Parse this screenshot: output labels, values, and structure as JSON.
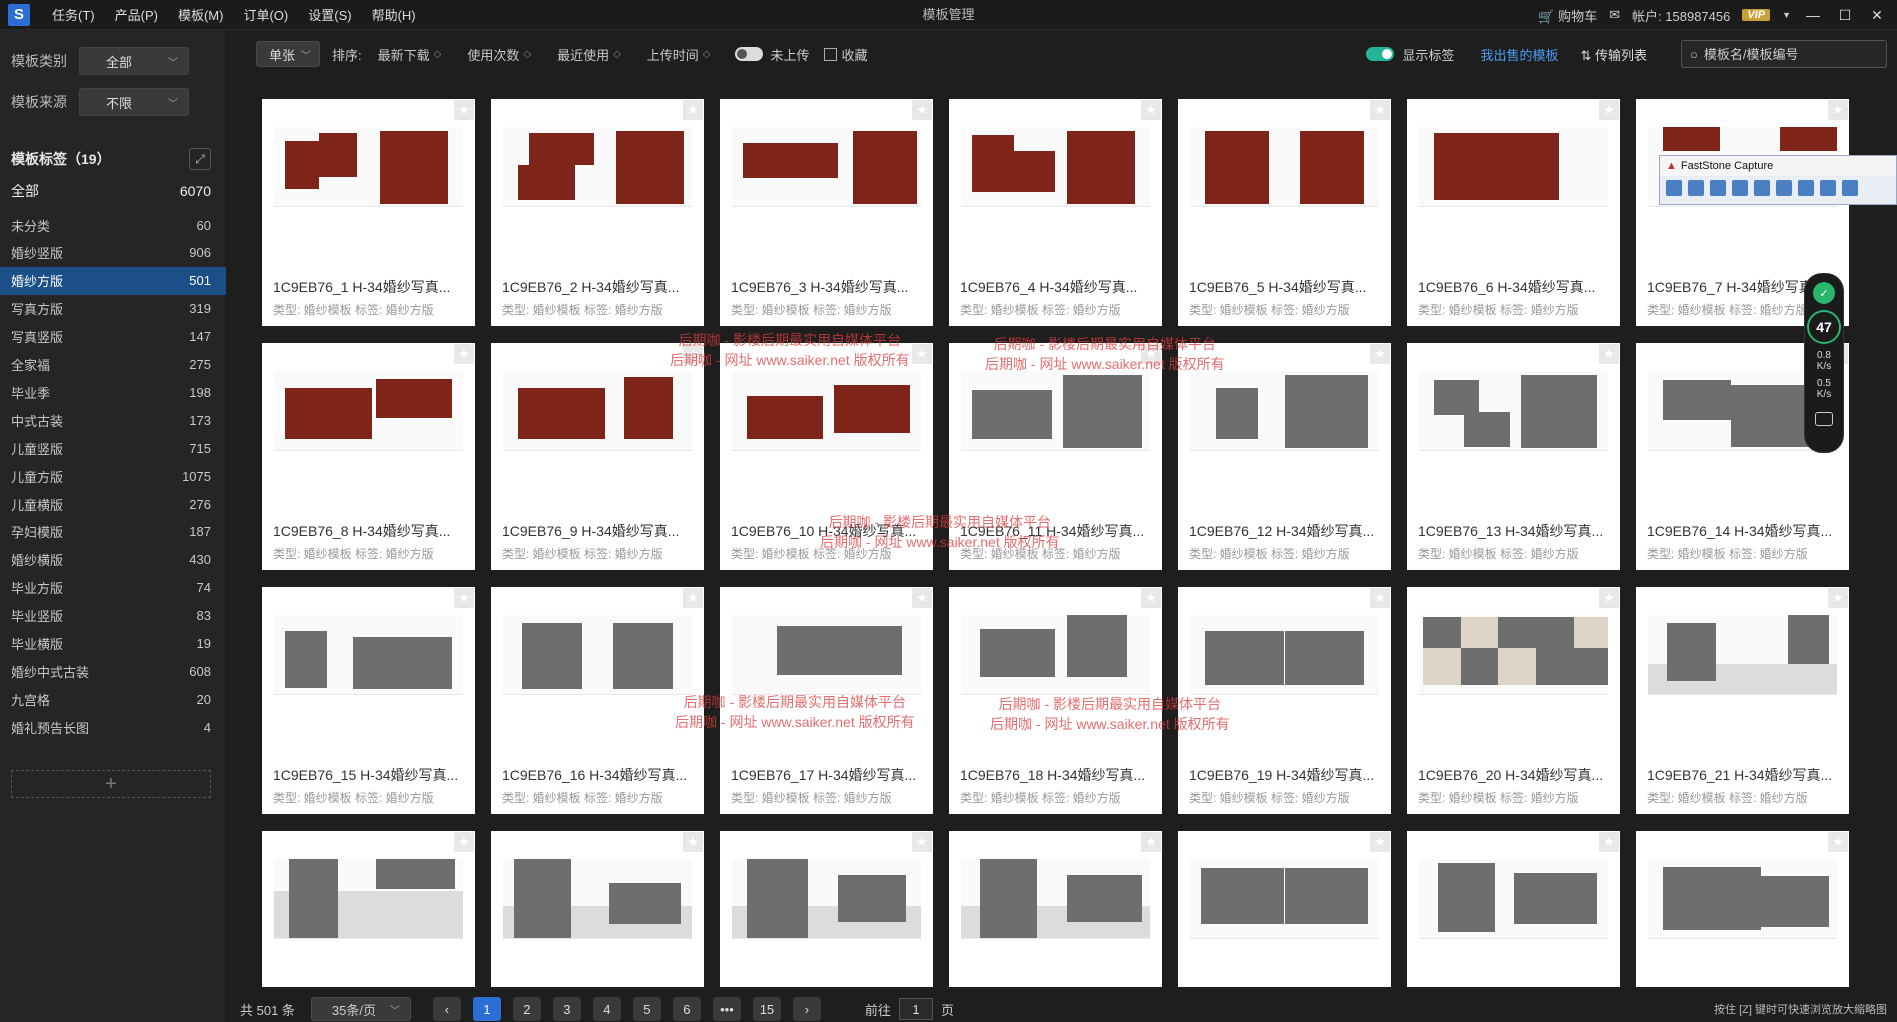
{
  "app": {
    "logo_letter": "S",
    "window_title": "模板管理",
    "menu": [
      "任务(T)",
      "产品(P)",
      "模板(M)",
      "订单(O)",
      "设置(S)",
      "帮助(H)"
    ],
    "cart_label": "购物车",
    "account_label": "帐户: 158987456",
    "vip_label": "VIP"
  },
  "sidebar": {
    "category_label": "模板类别",
    "category_value": "全部",
    "source_label": "模板来源",
    "source_value": "不限",
    "tags_title": "模板标签（19）",
    "tags": [
      {
        "name": "全部",
        "count": "6070"
      },
      {
        "name": "未分类",
        "count": "60"
      },
      {
        "name": "婚纱竖版",
        "count": "906"
      },
      {
        "name": "婚纱方版",
        "count": "501"
      },
      {
        "name": "写真方版",
        "count": "319"
      },
      {
        "name": "写真竖版",
        "count": "147"
      },
      {
        "name": "全家福",
        "count": "275"
      },
      {
        "name": "毕业季",
        "count": "198"
      },
      {
        "name": "中式古装",
        "count": "173"
      },
      {
        "name": "儿童竖版",
        "count": "715"
      },
      {
        "name": "儿童方版",
        "count": "1075"
      },
      {
        "name": "儿童横版",
        "count": "276"
      },
      {
        "name": "孕妇模版",
        "count": "187"
      },
      {
        "name": "婚纱横版",
        "count": "430"
      },
      {
        "name": "毕业方版",
        "count": "74"
      },
      {
        "name": "毕业竖版",
        "count": "83"
      },
      {
        "name": "毕业横版",
        "count": "19"
      },
      {
        "name": "婚纱中式古装",
        "count": "608"
      },
      {
        "name": "九宫格",
        "count": "20"
      },
      {
        "name": "婚礼预告长图",
        "count": "4"
      }
    ],
    "add_symbol": "+"
  },
  "toolbar": {
    "mode": "单张",
    "sort_label": "排序:",
    "sort_options": [
      "最新下载",
      "使用次数",
      "最近使用",
      "上传时间"
    ],
    "not_uploaded": "未上传",
    "favorites": "收藏",
    "show_tags": "显示标签",
    "my_sold": "我出售的模板",
    "transfer_list": "传输列表",
    "search_placeholder": "模板名/模板编号"
  },
  "cards": [
    {
      "name": "1C9EB76_1  H-34婚纱写真...",
      "meta": "类型: 婚纱模板    标签: 婚纱方版"
    },
    {
      "name": "1C9EB76_2  H-34婚纱写真...",
      "meta": "类型: 婚纱模板    标签: 婚纱方版"
    },
    {
      "name": "1C9EB76_3  H-34婚纱写真...",
      "meta": "类型: 婚纱模板    标签: 婚纱方版"
    },
    {
      "name": "1C9EB76_4  H-34婚纱写真...",
      "meta": "类型: 婚纱模板    标签: 婚纱方版"
    },
    {
      "name": "1C9EB76_5  H-34婚纱写真...",
      "meta": "类型: 婚纱模板    标签: 婚纱方版"
    },
    {
      "name": "1C9EB76_6  H-34婚纱写真...",
      "meta": "类型: 婚纱模板    标签: 婚纱方版"
    },
    {
      "name": "1C9EB76_7  H-34婚纱写真...",
      "meta": "类型: 婚纱模板    标签: 婚纱方版"
    },
    {
      "name": "1C9EB76_8  H-34婚纱写真...",
      "meta": "类型: 婚纱模板    标签: 婚纱方版"
    },
    {
      "name": "1C9EB76_9  H-34婚纱写真...",
      "meta": "类型: 婚纱模板    标签: 婚纱方版"
    },
    {
      "name": "1C9EB76_10  H-34婚纱写真...",
      "meta": "类型: 婚纱模板    标签: 婚纱方版"
    },
    {
      "name": "1C9EB76_11  H-34婚纱写真...",
      "meta": "类型: 婚纱模板    标签: 婚纱方版"
    },
    {
      "name": "1C9EB76_12  H-34婚纱写真...",
      "meta": "类型: 婚纱模板    标签: 婚纱方版"
    },
    {
      "name": "1C9EB76_13  H-34婚纱写真...",
      "meta": "类型: 婚纱模板    标签: 婚纱方版"
    },
    {
      "name": "1C9EB76_14  H-34婚纱写真...",
      "meta": "类型: 婚纱模板    标签: 婚纱方版"
    },
    {
      "name": "1C9EB76_15  H-34婚纱写真...",
      "meta": "类型: 婚纱模板    标签: 婚纱方版"
    },
    {
      "name": "1C9EB76_16  H-34婚纱写真...",
      "meta": "类型: 婚纱模板    标签: 婚纱方版"
    },
    {
      "name": "1C9EB76_17  H-34婚纱写真...",
      "meta": "类型: 婚纱模板    标签: 婚纱方版"
    },
    {
      "name": "1C9EB76_18  H-34婚纱写真...",
      "meta": "类型: 婚纱模板    标签: 婚纱方版"
    },
    {
      "name": "1C9EB76_19  H-34婚纱写真...",
      "meta": "类型: 婚纱模板    标签: 婚纱方版"
    },
    {
      "name": "1C9EB76_20  H-34婚纱写真...",
      "meta": "类型: 婚纱模板    标签: 婚纱方版"
    },
    {
      "name": "1C9EB76_21  H-34婚纱写真...",
      "meta": "类型: 婚纱模板    标签: 婚纱方版"
    },
    {
      "name": "",
      "meta": ""
    },
    {
      "name": "",
      "meta": ""
    },
    {
      "name": "",
      "meta": ""
    },
    {
      "name": "",
      "meta": ""
    },
    {
      "name": "",
      "meta": ""
    },
    {
      "name": "",
      "meta": ""
    },
    {
      "name": "",
      "meta": ""
    }
  ],
  "pagination": {
    "total": "共 501 条",
    "per_page": "35条/页",
    "prev": "‹",
    "pages": [
      "1",
      "2",
      "3",
      "4",
      "5",
      "6",
      "•••",
      "15"
    ],
    "next": "›",
    "goto_label": "前往",
    "goto_value": "1",
    "page_suffix": "页",
    "hint": "按住 [Z] 键时可快速浏览放大缩略图"
  },
  "overlays": {
    "faststone_title": "FastStone Capture",
    "speed_percent": "47",
    "speed_up": "0.8",
    "speed_down": "0.5",
    "speed_unit": "K/s",
    "watermark_line1": "后期咖 - 影楼后期最实用自媒体平台",
    "watermark_line2": "后期咖 - 网址 www.saiker.net 版权所有"
  },
  "colors": {
    "accent": "#2b6fd6",
    "active_tag": "#1c4f88",
    "template_red": "#7e2418",
    "toggle_on": "#23b49a"
  }
}
